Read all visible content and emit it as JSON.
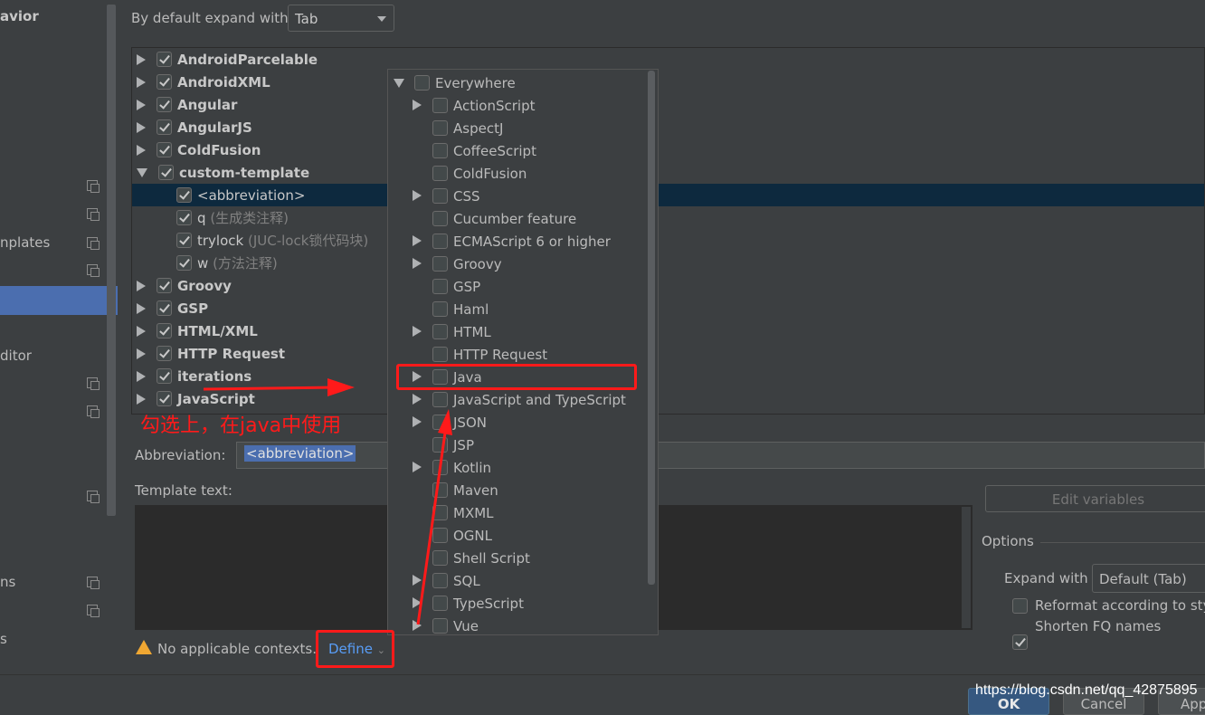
{
  "sidebar": {
    "items": [
      {
        "label": "avior",
        "bold": true
      },
      {
        "label": "nplates"
      },
      {
        "label": "ditor"
      },
      {
        "label": "ns"
      },
      {
        "label": "s"
      }
    ],
    "selected_item_color": "#4b6eaf"
  },
  "header": {
    "expand_label": "By default expand with",
    "expand_value": "Tab"
  },
  "tree": {
    "groups_top": [
      "AndroidParcelable",
      "AndroidXML",
      "Angular",
      "AngularJS",
      "ColdFusion"
    ],
    "expanded_group": "custom-template",
    "templates": [
      {
        "name": "<abbreviation>",
        "desc": "",
        "selected": true
      },
      {
        "name": "q",
        "desc": "(生成类注释)"
      },
      {
        "name": "trylock",
        "desc": "(JUC-lock锁代码块)"
      },
      {
        "name": "w",
        "desc": "(方法注释)"
      }
    ],
    "groups_bottom": [
      "Groovy",
      "GSP",
      "HTML/XML",
      "HTTP Request",
      "iterations",
      "JavaScript"
    ]
  },
  "context_popup": {
    "root": "Everywhere",
    "items": [
      {
        "label": "ActionScript",
        "expandable": true
      },
      {
        "label": "AspectJ",
        "expandable": false
      },
      {
        "label": "CoffeeScript",
        "expandable": false
      },
      {
        "label": "ColdFusion",
        "expandable": false
      },
      {
        "label": "CSS",
        "expandable": true
      },
      {
        "label": "Cucumber feature",
        "expandable": false
      },
      {
        "label": "ECMAScript 6 or higher",
        "expandable": true
      },
      {
        "label": "Groovy",
        "expandable": true
      },
      {
        "label": "GSP",
        "expandable": false
      },
      {
        "label": "Haml",
        "expandable": false
      },
      {
        "label": "HTML",
        "expandable": true
      },
      {
        "label": "HTTP Request",
        "expandable": false
      },
      {
        "label": "Java",
        "expandable": true
      },
      {
        "label": "JavaScript and TypeScript",
        "expandable": true
      },
      {
        "label": "JSON",
        "expandable": true
      },
      {
        "label": "JSP",
        "expandable": false
      },
      {
        "label": "Kotlin",
        "expandable": true
      },
      {
        "label": "Maven",
        "expandable": false
      },
      {
        "label": "MXML",
        "expandable": false
      },
      {
        "label": "OGNL",
        "expandable": false
      },
      {
        "label": "Shell Script",
        "expandable": false
      },
      {
        "label": "SQL",
        "expandable": true
      },
      {
        "label": "TypeScript",
        "expandable": true
      },
      {
        "label": "Vue",
        "expandable": true
      }
    ]
  },
  "editor": {
    "abbreviation_label": "Abbreviation:",
    "abbreviation_value": "<abbreviation>",
    "template_text_label": "Template text:",
    "warning": "No applicable contexts.",
    "define_label": "Define"
  },
  "options": {
    "edit_variables": "Edit variables",
    "title": "Options",
    "expand_with_label": "Expand with",
    "expand_with_value": "Default (Tab)",
    "reformat_label": "Reformat according to sty",
    "reformat_checked": false,
    "shorten_label": "Shorten FQ names",
    "shorten_checked": true
  },
  "footer": {
    "ok": "OK",
    "cancel": "Cancel",
    "apply": "App",
    "watermark": "https://blog.csdn.net/qq_42875895"
  },
  "annotation": {
    "text": "勾选上，在java中使用",
    "color": "#ff1a1a"
  }
}
